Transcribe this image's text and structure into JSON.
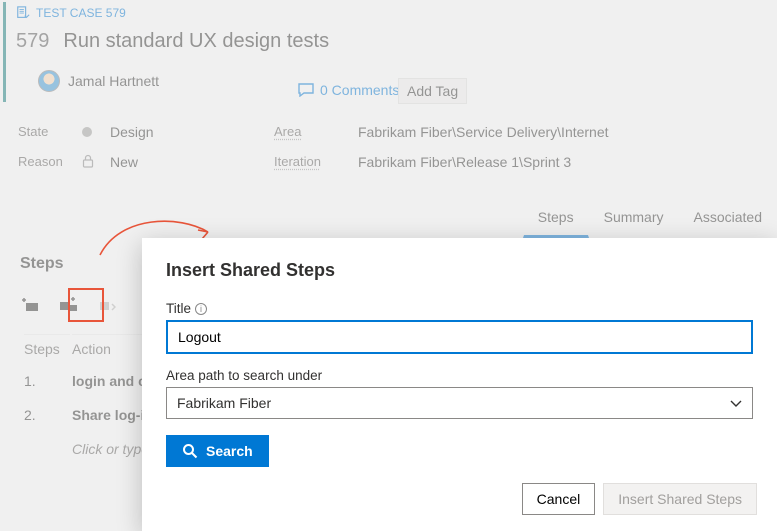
{
  "workitem": {
    "type_label": "TEST CASE 579",
    "id": "579",
    "title": "Run standard UX design tests",
    "assigned_to": "Jamal Hartnett",
    "comments_label": "0 Comments",
    "add_tag_label": "Add Tag"
  },
  "meta": {
    "state_label": "State",
    "state_value": "Design",
    "reason_label": "Reason",
    "reason_value": "New",
    "area_label": "Area",
    "area_value": "Fabrikam Fiber\\Service Delivery\\Internet",
    "iteration_label": "Iteration",
    "iteration_value": "Fabrikam Fiber\\Release 1\\Sprint 3"
  },
  "tabs": {
    "steps": "Steps",
    "summary": "Summary",
    "associated": "Associated"
  },
  "steps_section": {
    "heading": "Steps",
    "col_steps": "Steps",
    "col_action": "Action",
    "rows": [
      {
        "num": "1.",
        "action": "login and change password"
      },
      {
        "num": "2.",
        "action": "Share log-in information"
      }
    ],
    "hint": "Click or type here to add a step"
  },
  "dialog": {
    "heading": "Insert Shared Steps",
    "title_label": "Title",
    "title_value": "Logout",
    "area_label": "Area path to search under",
    "area_value": "Fabrikam Fiber",
    "search_label": "Search",
    "cancel_label": "Cancel",
    "submit_label": "Insert Shared Steps"
  }
}
